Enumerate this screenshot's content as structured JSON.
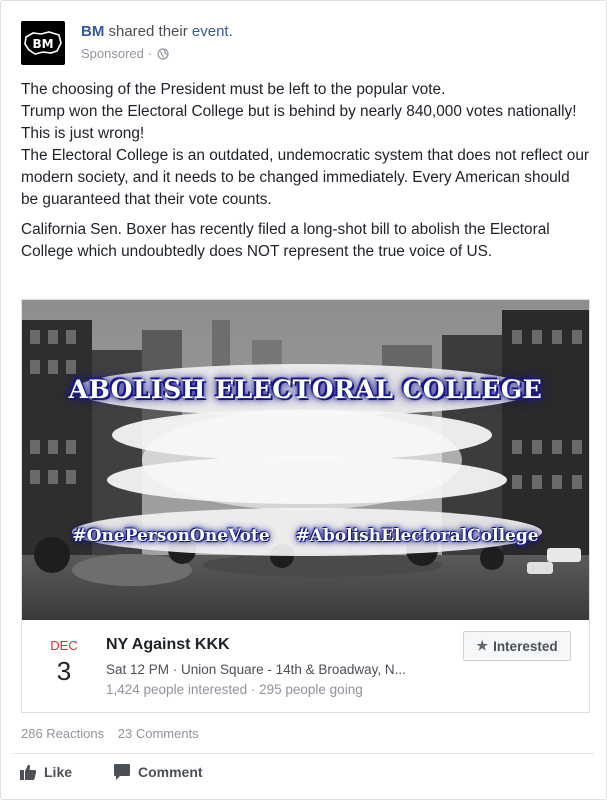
{
  "post": {
    "page_name": "BM",
    "action_text": "shared their",
    "event_link": "event.",
    "sponsored": "Sponsored",
    "separator": "·",
    "privacy_icon": "globe-icon",
    "avatar_text": "BM",
    "paragraphs": [
      "The choosing of the President must be left to the popular vote.",
      "Trump won the Electoral College but is behind by nearly 840,000 votes nationally! This is just wrong!",
      "The Electoral College is an outdated, undemocratic system that does not reflect our modern society, and it needs to be changed immediately. Every American should be guaranteed that their vote counts.",
      "California Sen. Boxer has recently filed a long-shot bill to abolish the Electoral College which undoubtedly does NOT represent the true voice of US."
    ]
  },
  "event": {
    "image_title": "ABOLISH ELECTORAL COLLEGE",
    "hashtag_1": "#OnePersonOneVote",
    "hashtag_2": "#AbolishElectoralCollege",
    "month": "DEC",
    "day": "3",
    "title": "NY Against KKK",
    "when_where": "Sat 12 PM · Union Square - 14th & Broadway, N...",
    "stats": "1,424 people interested · 295 people going",
    "interested_label": "Interested",
    "interested_icon": "star-icon"
  },
  "engagement": {
    "reactions": "286 Reactions",
    "comments": "23 Comments"
  },
  "actions": {
    "like_label": "Like",
    "like_icon": "thumbs-up-icon",
    "comment_label": "Comment",
    "comment_icon": "speech-bubble-icon"
  },
  "colors": {
    "link_blue": "#365899",
    "date_red": "#e62d2d",
    "overlay_text_glow": "#1a1a8c"
  }
}
